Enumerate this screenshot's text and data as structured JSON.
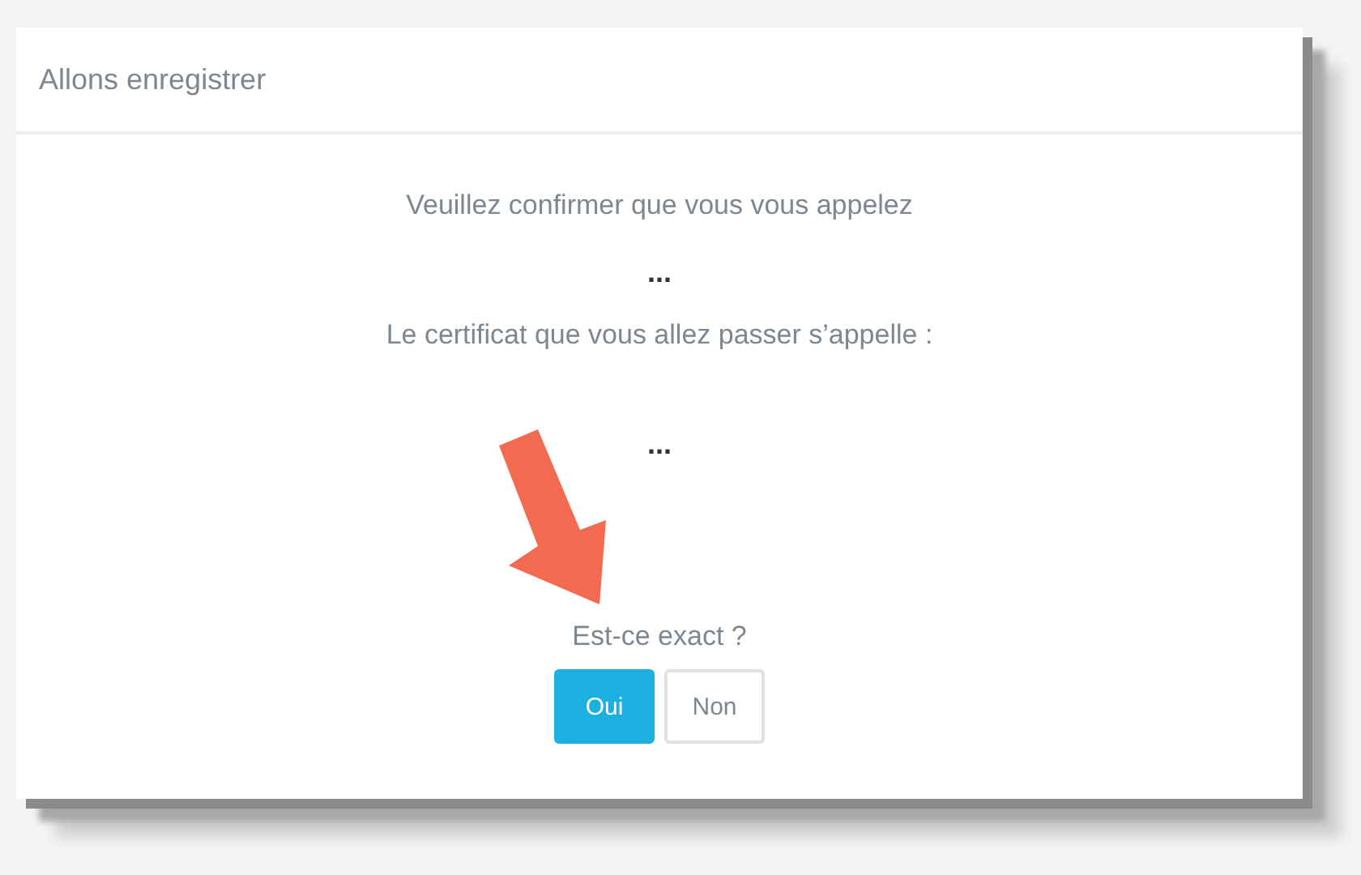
{
  "dialog": {
    "title": "Allons enregistrer",
    "lines": [
      {
        "kind": "text",
        "text": "Veuillez confirmer que vous vous appelez"
      },
      {
        "kind": "value",
        "text": "..."
      },
      {
        "kind": "text",
        "text": "Le certificat que vous allez passer s’appelle :"
      },
      {
        "kind": "value",
        "text": "..."
      }
    ],
    "question": "Est-ce exact ?",
    "buttons": [
      {
        "label": "Oui",
        "selected": true
      },
      {
        "label": "Non",
        "selected": false
      }
    ]
  }
}
